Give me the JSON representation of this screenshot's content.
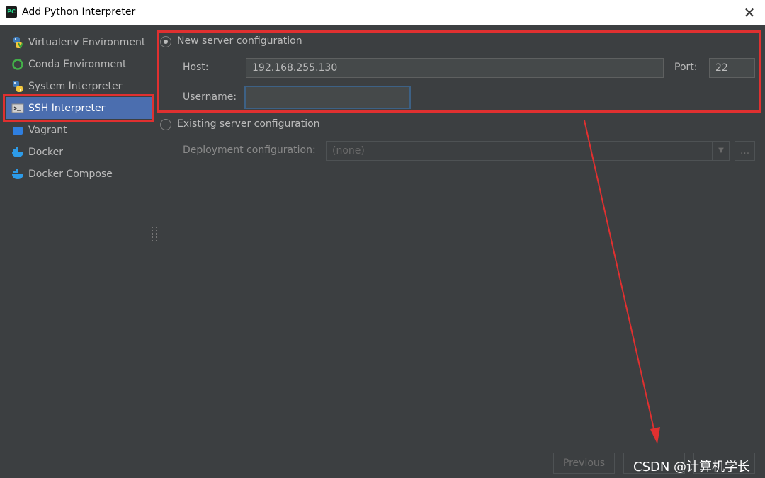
{
  "window": {
    "title": "Add Python Interpreter",
    "close_icon": "✕"
  },
  "sidebar": {
    "items": [
      {
        "label": "Virtualenv Environment",
        "icon": "python-icon"
      },
      {
        "label": "Conda Environment",
        "icon": "conda-icon"
      },
      {
        "label": "System Interpreter",
        "icon": "python-icon"
      },
      {
        "label": "SSH Interpreter",
        "icon": "terminal-icon",
        "selected": true
      },
      {
        "label": "Vagrant",
        "icon": "vagrant-icon"
      },
      {
        "label": "Docker",
        "icon": "docker-icon"
      },
      {
        "label": "Docker Compose",
        "icon": "docker-icon"
      }
    ]
  },
  "form": {
    "new_server_label": "New server configuration",
    "host_label": "Host:",
    "host_value": "192.168.255.130",
    "port_label": "Port:",
    "port_value": "22",
    "username_label": "Username:",
    "username_value": "",
    "existing_server_label": "Existing server configuration",
    "deployment_label": "Deployment configuration:",
    "deployment_value": "(none)",
    "dropdown_arrow": "▼",
    "browse_label": "..."
  },
  "footer": {
    "previous_label": "Previous"
  },
  "watermark": "CSDN @计算机学长",
  "colors": {
    "background": "#3c3f41",
    "selected": "#4b6eaf",
    "highlight": "#e03030",
    "focus": "#3d6185"
  }
}
